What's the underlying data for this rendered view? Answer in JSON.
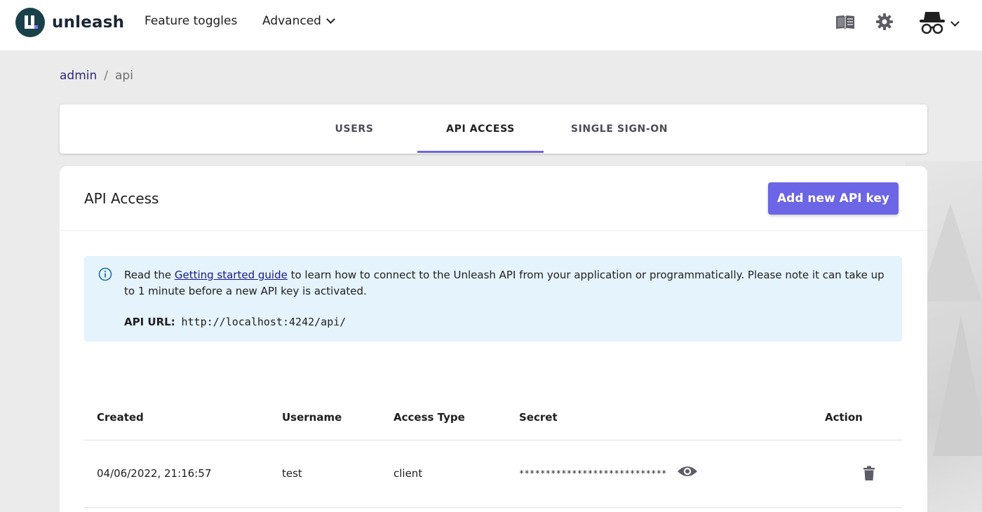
{
  "header": {
    "logo_text": "unleash",
    "nav": {
      "features_label": "Feature toggles",
      "advanced_label": "Advanced"
    },
    "icons": [
      "docs-book-icon",
      "gear-icon",
      "incognito-avatar-icon",
      "chevron-down-icon"
    ]
  },
  "breadcrumb": {
    "parent": "admin",
    "separator": "/",
    "current": "api"
  },
  "tabs": [
    {
      "label": "USERS",
      "active": false
    },
    {
      "label": "API ACCESS",
      "active": true
    },
    {
      "label": "SINGLE SIGN-ON",
      "active": false
    }
  ],
  "main": {
    "title": "API Access",
    "add_button_label": "Add new API key",
    "info": {
      "prefix": "Read the ",
      "link_text": "Getting started guide",
      "suffix": " to learn how to connect to the Unleash API from your application or programmatically. Please note it can take up to 1 minute before a new API key is activated.",
      "api_url_label": "API URL:",
      "api_url_value": "http://localhost:4242/api/"
    },
    "table": {
      "headers": [
        "Created",
        "Username",
        "Access Type",
        "Secret",
        "Action"
      ],
      "rows": [
        {
          "created": "04/06/2022, 21:16:57",
          "username": "test",
          "access_type": "client",
          "secret": "****************************"
        }
      ]
    }
  },
  "colors": {
    "primary": "#6c65e5",
    "info_bg": "#e5f3fd",
    "logo_bg": "#1a4049",
    "page_bg": "#ebebeb"
  }
}
